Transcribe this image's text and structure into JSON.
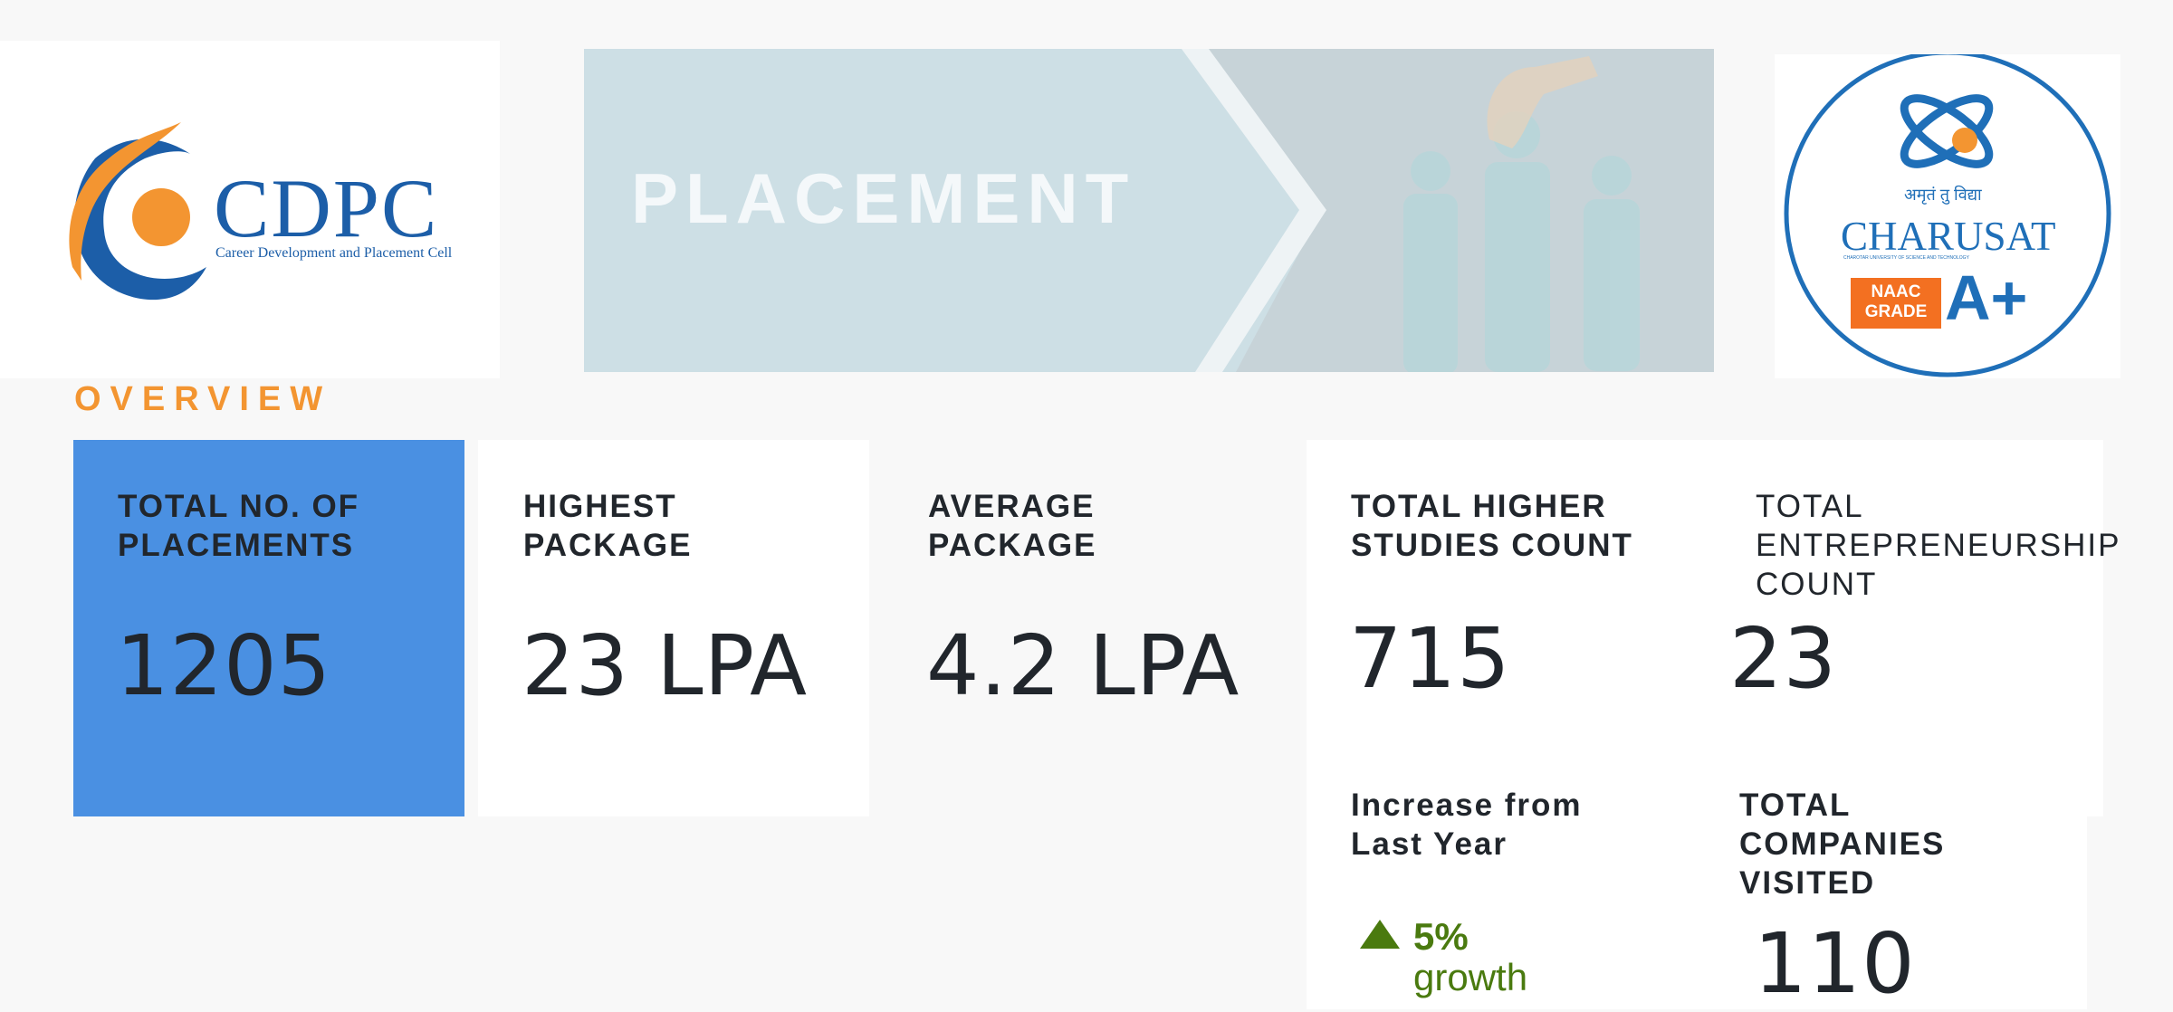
{
  "header": {
    "cdpc_logo": {
      "name": "CDPC",
      "tagline": "Career Development and Placement Cell"
    },
    "banner": {
      "text": "PLACEMENT"
    },
    "charusat_logo": {
      "motto": "अमृतं तु विद्या",
      "name": "CHARUSAT",
      "subtitle": "CHAROTAR UNIVERSITY OF SCIENCE AND TECHNOLOGY",
      "badge_text": "NAAC GRADE",
      "grade": "A+"
    }
  },
  "overview": {
    "heading": "OVERVIEW",
    "cards": {
      "placements": {
        "label_line1": "TOTAL NO. OF",
        "label_line2": "PLACEMENTS",
        "value": "1205"
      },
      "highest": {
        "label_line1": "HIGHEST",
        "label_line2": "PACKAGE",
        "value": "23 LPA"
      },
      "average": {
        "label_line1": "AVERAGE",
        "label_line2": "PACKAGE",
        "value": "4.2 LPA"
      },
      "higher_studies": {
        "label_line1": "TOTAL HIGHER",
        "label_line2": "STUDIES COUNT",
        "value": "715"
      },
      "entrepreneurship": {
        "label_line1": "TOTAL",
        "label_line2": "ENTREPRENEURSHIP",
        "label_line3": "COUNT",
        "value": "23"
      },
      "increase": {
        "label_line1": "Increase from",
        "label_line2": "Last Year",
        "value": "5%",
        "suffix": "growth",
        "icon": "triangle-up-icon"
      },
      "companies": {
        "label_line1": "TOTAL",
        "label_line2": "COMPANIES",
        "label_line3": "VISITED",
        "value": "110"
      }
    }
  },
  "colors": {
    "accent_orange": "#f39531",
    "card_blue": "#4a90e2",
    "growth_green": "#4a7a0f",
    "cdpc_blue": "#1c5ea8",
    "charusat_blue": "#1f6fb8"
  }
}
